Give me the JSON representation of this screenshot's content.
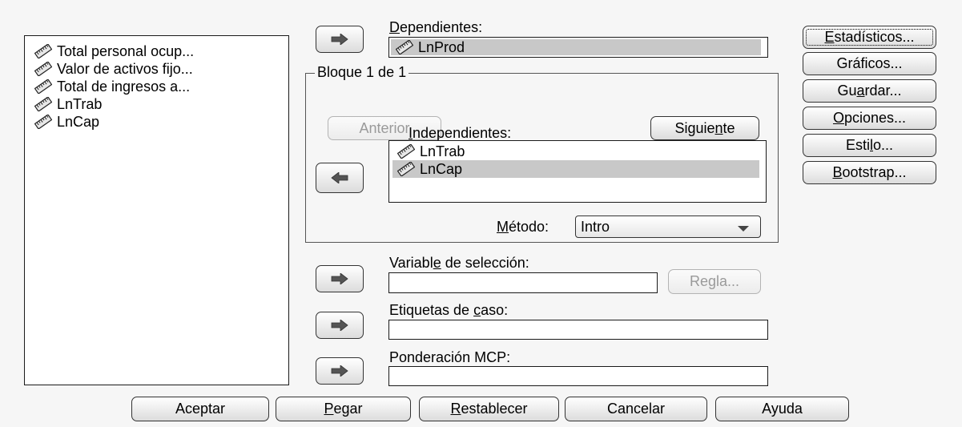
{
  "source_list": {
    "items": [
      {
        "label": "Total personal ocup...",
        "icon": "scale-variable-icon"
      },
      {
        "label": "Valor de activos fijo...",
        "icon": "scale-variable-icon"
      },
      {
        "label": "Total de ingresos a...",
        "icon": "scale-variable-icon"
      },
      {
        "label": "LnTrab",
        "icon": "scale-variable-icon"
      },
      {
        "label": "LnCap",
        "icon": "scale-variable-icon"
      }
    ]
  },
  "dependent": {
    "label": "Dependientes:",
    "label_accel": "D",
    "label_rest": "ependientes:",
    "value": "LnProd"
  },
  "block": {
    "title": "Bloque 1 de 1",
    "prev_label": "Anterior",
    "next_label": "Siguiente",
    "next_pre": "Siguie",
    "next_accel": "n",
    "next_post": "te"
  },
  "independent": {
    "label": "Independientes:",
    "label_accel": "I",
    "label_rest": "ndependientes:",
    "items": [
      "LnTrab",
      "LnCap"
    ],
    "selected_index": 1
  },
  "method": {
    "label": "Método:",
    "label_accel": "M",
    "label_rest": "étodo:",
    "value": "Intro"
  },
  "selection_var": {
    "label": "Variable de selección:",
    "pre": "Variabl",
    "accel": "e",
    "post": " de selección:",
    "value": "",
    "rule_label": "Regla..."
  },
  "case_labels": {
    "label": "Etiquetas de caso:",
    "pre": "Etiquetas de ",
    "accel": "c",
    "post": "aso:",
    "value": ""
  },
  "wls_weight": {
    "label": "Ponderación MCP:",
    "value": ""
  },
  "side_buttons": {
    "statistics": {
      "label": "Estadísticos...",
      "pre": "",
      "accel": "E",
      "post": "stadísticos..."
    },
    "plots": {
      "label": "Gráficos...",
      "pre": "Gráficos...",
      "accel": "",
      "post": ""
    },
    "save": {
      "label": "Guardar...",
      "pre": "Gu",
      "accel": "a",
      "post": "rdar..."
    },
    "options": {
      "label": "Opciones...",
      "pre": "",
      "accel": "O",
      "post": "pciones..."
    },
    "style": {
      "label": "Estilo...",
      "pre": "Esti",
      "accel": "l",
      "post": "o..."
    },
    "bootstrap": {
      "label": "Bootstrap...",
      "pre": "",
      "accel": "B",
      "post": "ootstrap..."
    }
  },
  "bottom_buttons": {
    "ok": {
      "label": "Aceptar",
      "pre": "Aceptar",
      "accel": "",
      "post": ""
    },
    "paste": {
      "label": "Pegar",
      "pre": "",
      "accel": "P",
      "post": "egar"
    },
    "reset": {
      "label": "Restablecer",
      "pre": "",
      "accel": "R",
      "post": "establecer"
    },
    "cancel": {
      "label": "Cancelar",
      "pre": "Cancelar",
      "accel": "",
      "post": ""
    },
    "help": {
      "label": "Ayuda",
      "pre": "Ayuda",
      "accel": "",
      "post": ""
    }
  },
  "colors": {
    "selection": "#c8c8c8",
    "background": "#f6f6f6"
  }
}
